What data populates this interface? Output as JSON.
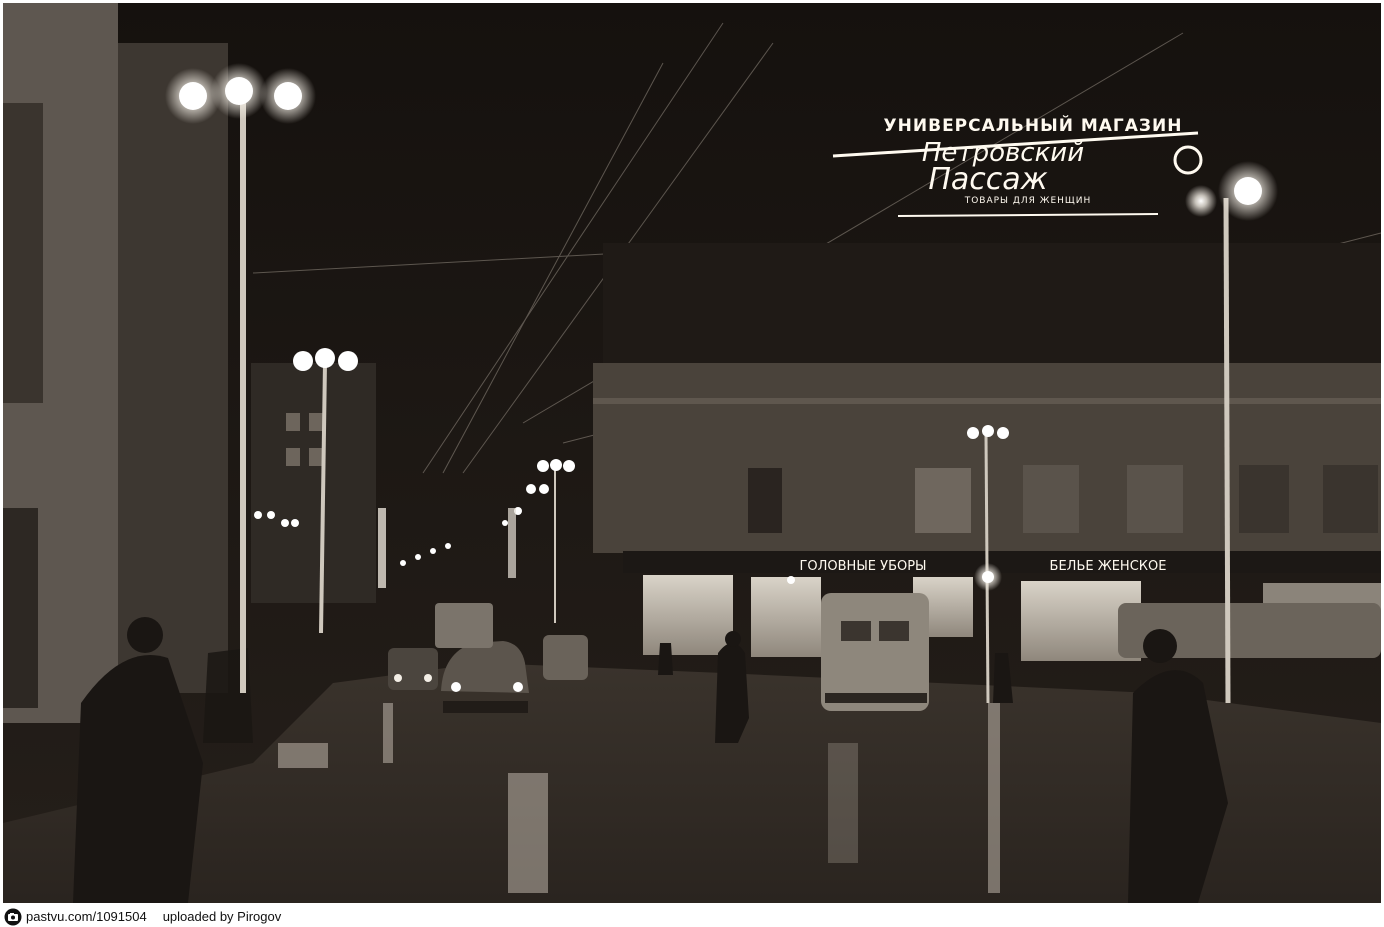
{
  "photo": {
    "sign": {
      "top_line": "УНИВЕРСАЛЬНЫЙ МАГАЗИН",
      "script_line_1": "Петровский",
      "script_line_2": "Пассаж",
      "bottom_line": "ТОВАРЫ  ДЛЯ  ЖЕНЩИН"
    },
    "shop_signs": {
      "hats": "ГОЛОВНЫЕ УБОРЫ",
      "lingerie": "БЕЛЬЕ ЖЕНСКОЕ"
    }
  },
  "caption": {
    "icon": "camera-icon",
    "photo_link": "pastvu.com/1091504",
    "uploader": "uploaded by Pirogov"
  }
}
